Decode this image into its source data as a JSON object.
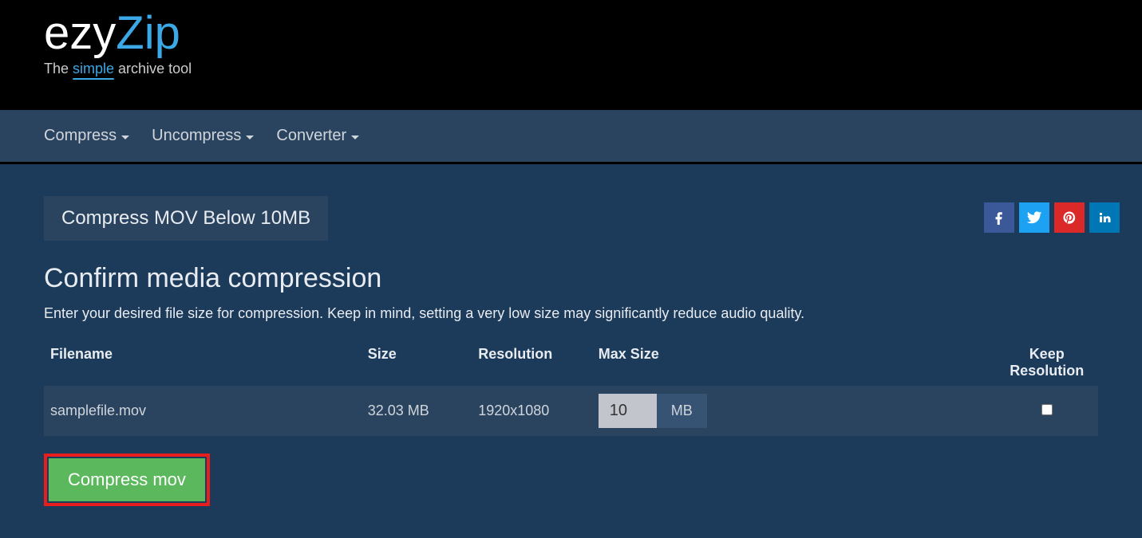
{
  "logo": {
    "part1": "ezy",
    "part2": "Zip",
    "tagline_pre": "The ",
    "tagline_mid": "simple",
    "tagline_post": " archive tool"
  },
  "nav": {
    "compress": "Compress",
    "uncompress": "Uncompress",
    "converter": "Converter"
  },
  "tab_label": "Compress MOV Below 10MB",
  "section": {
    "title": "Confirm media compression",
    "desc": "Enter your desired file size for compression. Keep in mind, setting a very low size may significantly reduce audio quality."
  },
  "table": {
    "headers": {
      "filename": "Filename",
      "size": "Size",
      "resolution": "Resolution",
      "maxsize": "Max Size",
      "keep": "Keep Resolution"
    },
    "row": {
      "filename": "samplefile.mov",
      "size": "32.03 MB",
      "resolution": "1920x1080",
      "maxsize_value": "10",
      "maxsize_unit": "MB"
    }
  },
  "button": {
    "compress": "Compress mov"
  },
  "social": {
    "facebook": "facebook",
    "twitter": "twitter",
    "pinterest": "pinterest",
    "linkedin": "linkedin"
  }
}
